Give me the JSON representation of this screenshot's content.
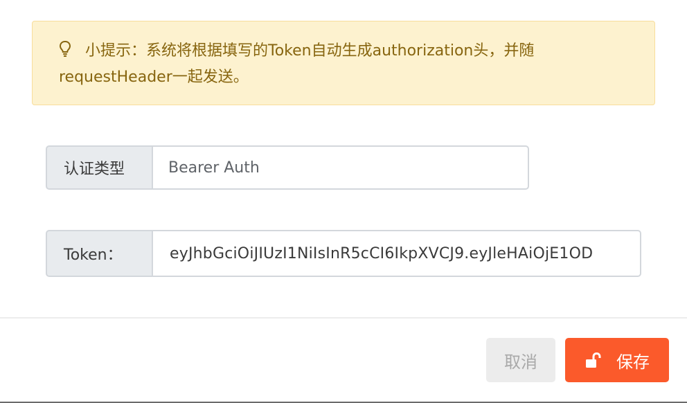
{
  "tip": {
    "icon": "lightbulb-icon",
    "line1": "小提示：系统将根据填写的Token自动生成authorization头，并随",
    "line2": "requestHeader一起发送。"
  },
  "auth": {
    "label": "认证类型",
    "value": "Bearer Auth"
  },
  "token": {
    "label": "Token：",
    "value": "eyJhbGciOiJIUzI1NiIsInR5cCI6IkpXVCJ9.eyJleHAiOjE1OD"
  },
  "actions": {
    "cancel_label": "取消",
    "save_label": "保存",
    "save_icon": "unlock-icon"
  },
  "colors": {
    "tip_background": "#fdf2cf",
    "tip_text": "#87650f",
    "save_button": "#fb5a2b",
    "cancel_button": "#ececec"
  }
}
